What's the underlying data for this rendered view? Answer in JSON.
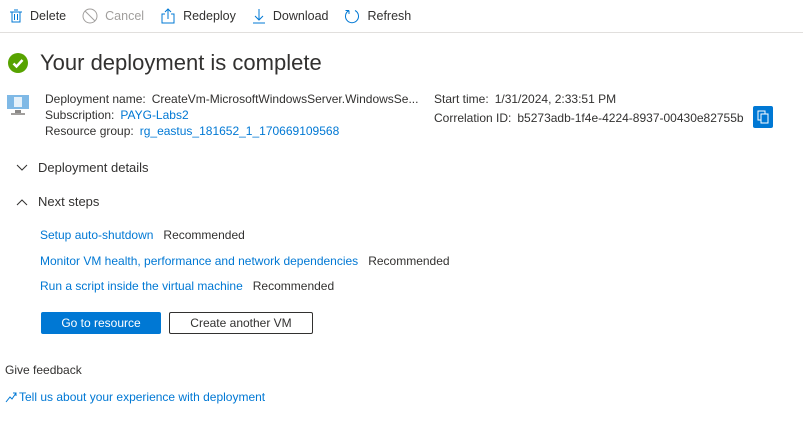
{
  "toolbar": {
    "delete": "Delete",
    "cancel": "Cancel",
    "redeploy": "Redeploy",
    "download": "Download",
    "refresh": "Refresh"
  },
  "title": "Your deployment is complete",
  "details": {
    "name_label": "Deployment name:",
    "name": "CreateVm-MicrosoftWindowsServer.WindowsSe...",
    "sub_label": "Subscription:",
    "sub": "PAYG-Labs2",
    "rg_label": "Resource group:",
    "rg": "rg_eastus_181652_1_170669109568",
    "start_label": "Start time:",
    "start": "1/31/2024, 2:33:51 PM",
    "corr_label": "Correlation ID:",
    "corr": "b5273adb-1f4e-4224-8937-00430e82755b"
  },
  "sections": {
    "details": "Deployment details",
    "next": "Next steps"
  },
  "steps": [
    {
      "link": "Setup auto-shutdown",
      "tag": "Recommended"
    },
    {
      "link": "Monitor VM health, performance and network dependencies",
      "tag": "Recommended"
    },
    {
      "link": "Run a script inside the virtual machine",
      "tag": "Recommended"
    }
  ],
  "buttons": {
    "go": "Go to resource",
    "create": "Create another VM"
  },
  "feedback": {
    "heading": "Give feedback",
    "link": "Tell us about your experience with deployment"
  }
}
